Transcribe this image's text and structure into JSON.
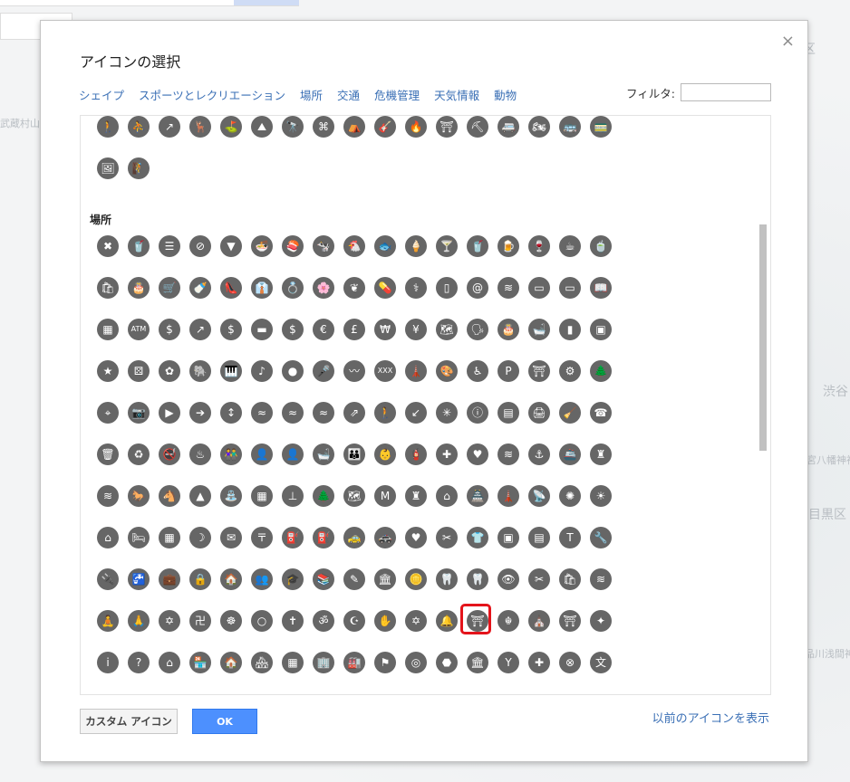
{
  "map": {
    "labels": [
      "区",
      "武蔵村山",
      "渋谷",
      "目黒区",
      "宮八幡神社",
      "品川浅間神社"
    ]
  },
  "dialog": {
    "title": "アイコンの選択",
    "close": "×",
    "categories": [
      "シェイプ",
      "スポーツとレクリエーション",
      "場所",
      "交通",
      "危機管理",
      "天気情報",
      "動物"
    ],
    "filter_label": "フィルタ:",
    "filter_value": "",
    "section_places": "場所",
    "custom_button": "カスタム アイコン",
    "ok_button": "OK",
    "prev_link": "以前のアイコンを表示"
  },
  "icons": {
    "sports_row1": [
      "🚶",
      "⛹",
      "↗",
      "🦌",
      "⛳",
      "⛰",
      "🔭",
      "⌘",
      "⛺",
      "🎸",
      "🔥",
      "⛩",
      "⛏",
      "🚐",
      "🏍",
      "🚌",
      "🚃"
    ],
    "sports_row2": [
      "🖼",
      "🧗"
    ],
    "places": [
      [
        "✖",
        "🥤",
        "☰",
        "⊘",
        "▼",
        "🍜",
        "🍣",
        "🐄",
        "🐔",
        "🐟",
        "🍦",
        "🍸",
        "🥤",
        "🍺",
        "🍷",
        "☕",
        "🍵"
      ],
      [
        "🛍",
        "🎂",
        "🛒",
        "🍼",
        "👠",
        "👔",
        "💍",
        "🌸",
        "❦",
        "💊",
        "⚕",
        "▯",
        "@",
        "≋",
        "▭",
        "▭",
        "📖"
      ],
      [
        "▦",
        "ATM",
        "$",
        "↗",
        "$",
        "▬",
        "$",
        "€",
        "£",
        "₩",
        "¥",
        "🗺",
        "🗣",
        "🎂",
        "🛁",
        "▮",
        "▣"
      ],
      [
        "★",
        "⚄",
        "✿",
        "🐘",
        "🎹",
        "♪",
        "●",
        "🎤",
        "〰",
        "XXX",
        "🗼",
        "🎨",
        "♿",
        "P",
        "⛩",
        "⚙",
        "🌲"
      ],
      [
        "⌖",
        "📷",
        "▶",
        "➔",
        "↕",
        "≈",
        "≈",
        "≈",
        "⇗",
        "🚶",
        "↙",
        "✳",
        "ⓘ",
        "▤",
        "🖨",
        "🧹",
        "☎"
      ],
      [
        "🗑",
        "♻",
        "🚭",
        "♨",
        "👫",
        "👤",
        "👤",
        "🛁",
        "👪",
        "👶",
        "🧯",
        "✚",
        "♥",
        "≋",
        "⚓",
        "🚢",
        "♜"
      ],
      [
        "≋",
        "🐎",
        "🐴",
        "▲",
        "⛲",
        "▦",
        "⊥",
        "🌲",
        "🗺",
        "M",
        "♜",
        "⌂",
        "🏯",
        "🗼",
        "📡",
        "✺",
        "☀"
      ],
      [
        "⌂",
        "🛏",
        "▦",
        "☽",
        "✉",
        "〒",
        "⛽",
        "⛽",
        "🚕",
        "🚓",
        "♥",
        "✂",
        "👕",
        "▣",
        "▤",
        "T",
        "🔧"
      ],
      [
        "🔌",
        "🚰",
        "💼",
        "🔒",
        "🏠",
        "👥",
        "🎓",
        "📚",
        "✎",
        "🏛",
        "🪙",
        "🦷",
        "🦷",
        "👁",
        "✂",
        "🛍",
        "≋"
      ],
      [
        "🧘",
        "🙏",
        "✡",
        "卍",
        "☸",
        "○",
        "✝",
        "ॐ",
        "☪",
        "✋",
        "✡",
        "🔔",
        "⛩",
        "☬",
        "⛪",
        "⛩",
        "✦"
      ],
      [
        "i",
        "?",
        "⌂",
        "🏪",
        "🏠",
        "🏘",
        "▦",
        "🏢",
        "🏭",
        "⚑",
        "◎",
        "⬣",
        "🏛",
        "Y",
        "✚",
        "⊗",
        "文"
      ]
    ]
  },
  "colors": {
    "icon": "#666666",
    "selection": "#e4141b",
    "link": "#3a6fb5",
    "ok_button": "#4d90fe"
  }
}
